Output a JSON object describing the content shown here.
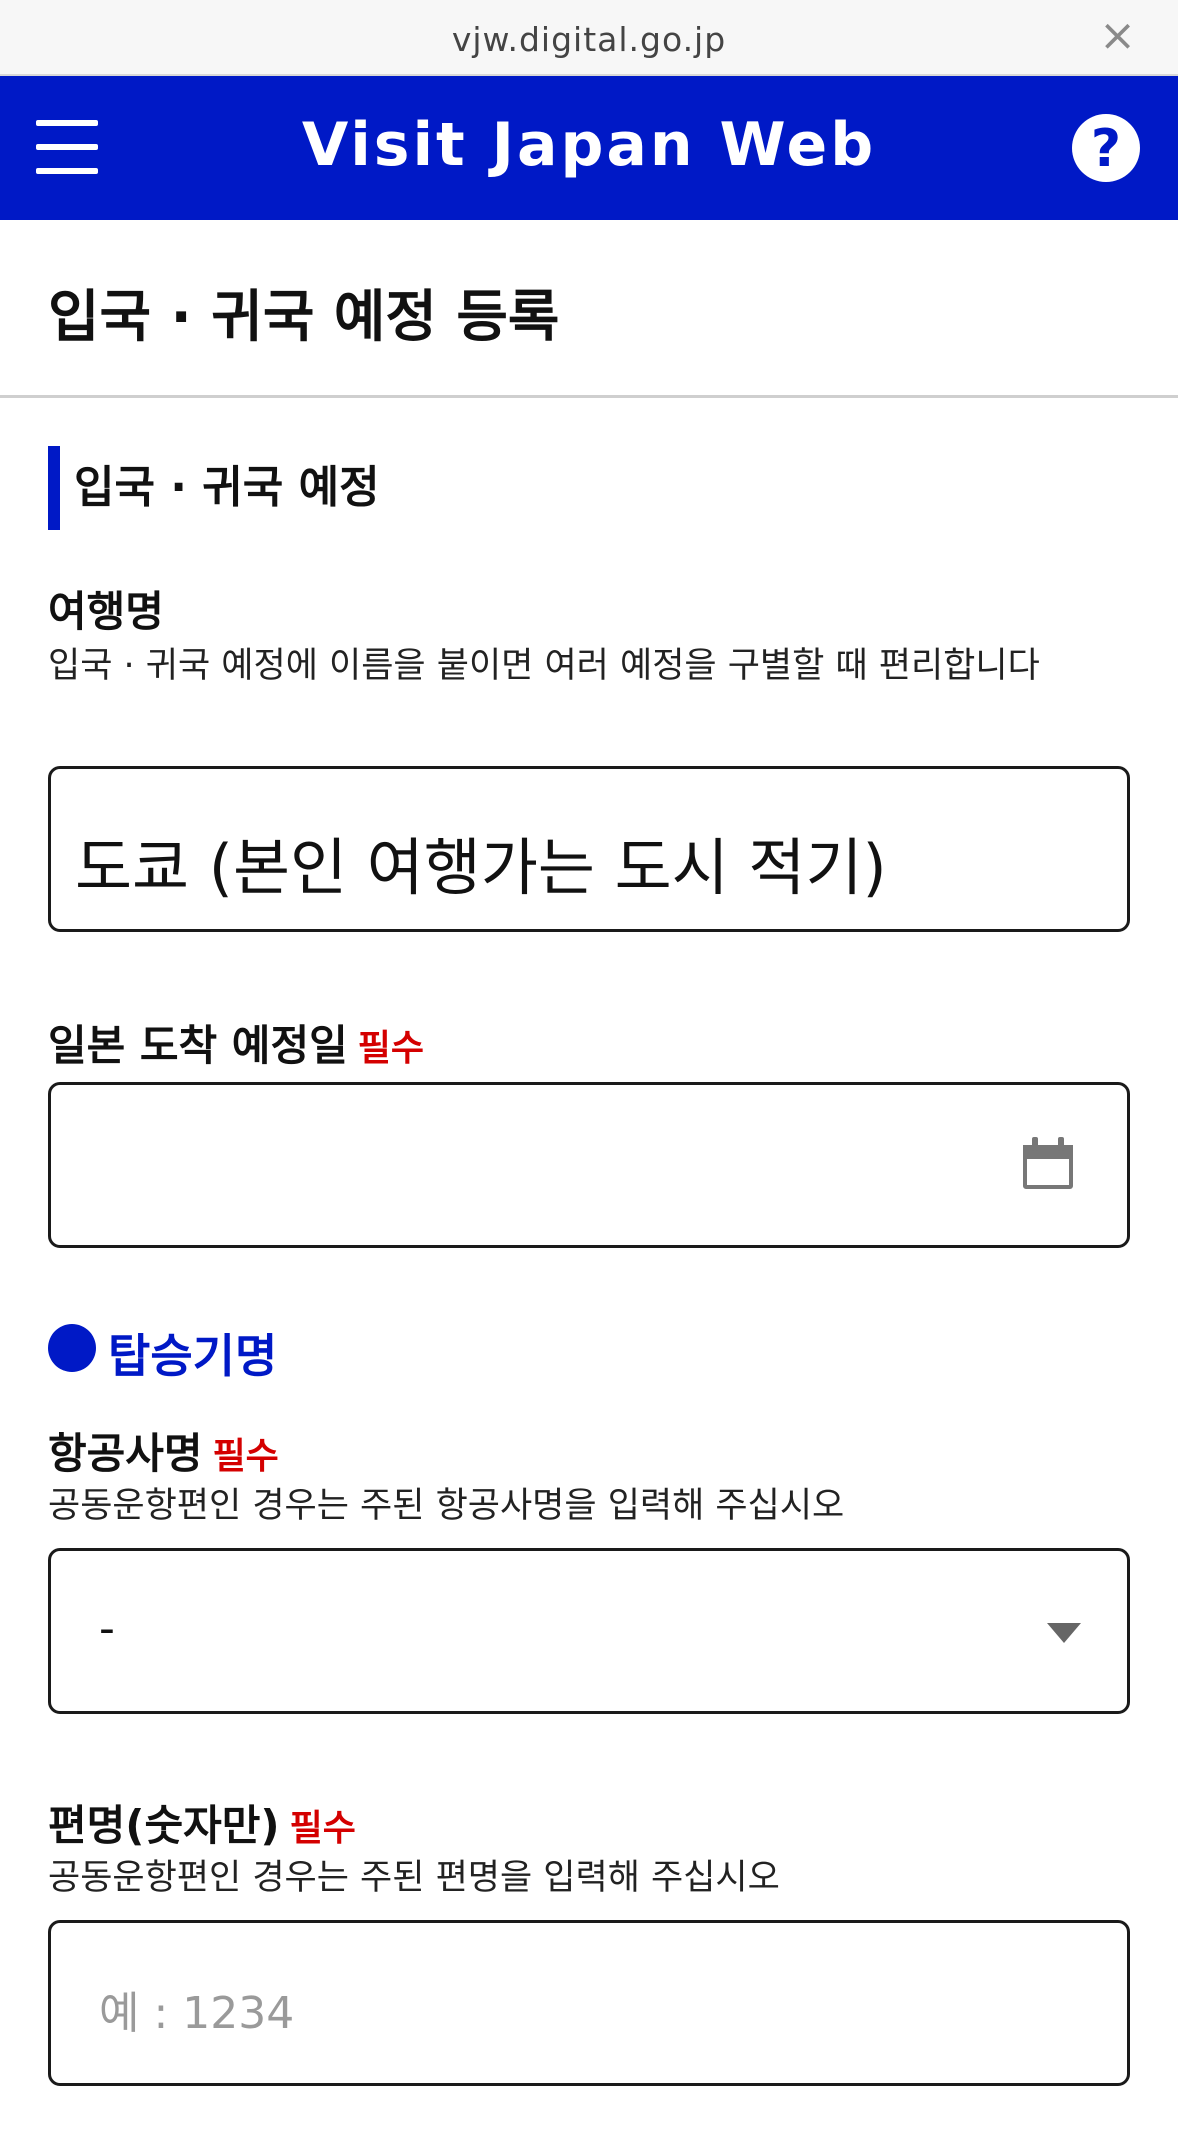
{
  "browser": {
    "url": "vjw.digital.go.jp",
    "close_glyph": "×"
  },
  "header": {
    "title": "Visit Japan Web",
    "help_glyph": "?"
  },
  "page": {
    "title": "입국 · 귀국 예정 등록"
  },
  "section": {
    "heading": "입국 · 귀국 예정"
  },
  "trip_name": {
    "label": "여행명",
    "help": "입국 · 귀국 예정에 이름을 붙이면 여러 예정을 구별할 때 편리합니다",
    "value": "도쿄 (본인 여행가는 도시 적기)"
  },
  "arrival_date": {
    "label": "일본 도착 예정일",
    "required": "필수",
    "value": "",
    "icon": "calendar-icon"
  },
  "flight": {
    "heading": "탑승기명"
  },
  "airline": {
    "label": "항공사명",
    "required": "필수",
    "help": "공동운항편인 경우는 주된 항공사명을 입력해 주십시오",
    "selected": "-"
  },
  "flight_number": {
    "label": "편명(숫자만)",
    "required": "필수",
    "help": "공동운항편인 경우는 주된 편명을 입력해 주십시오",
    "placeholder": "예 : 1234"
  },
  "colors": {
    "brand": "#0019c6",
    "required": "#d40000"
  }
}
